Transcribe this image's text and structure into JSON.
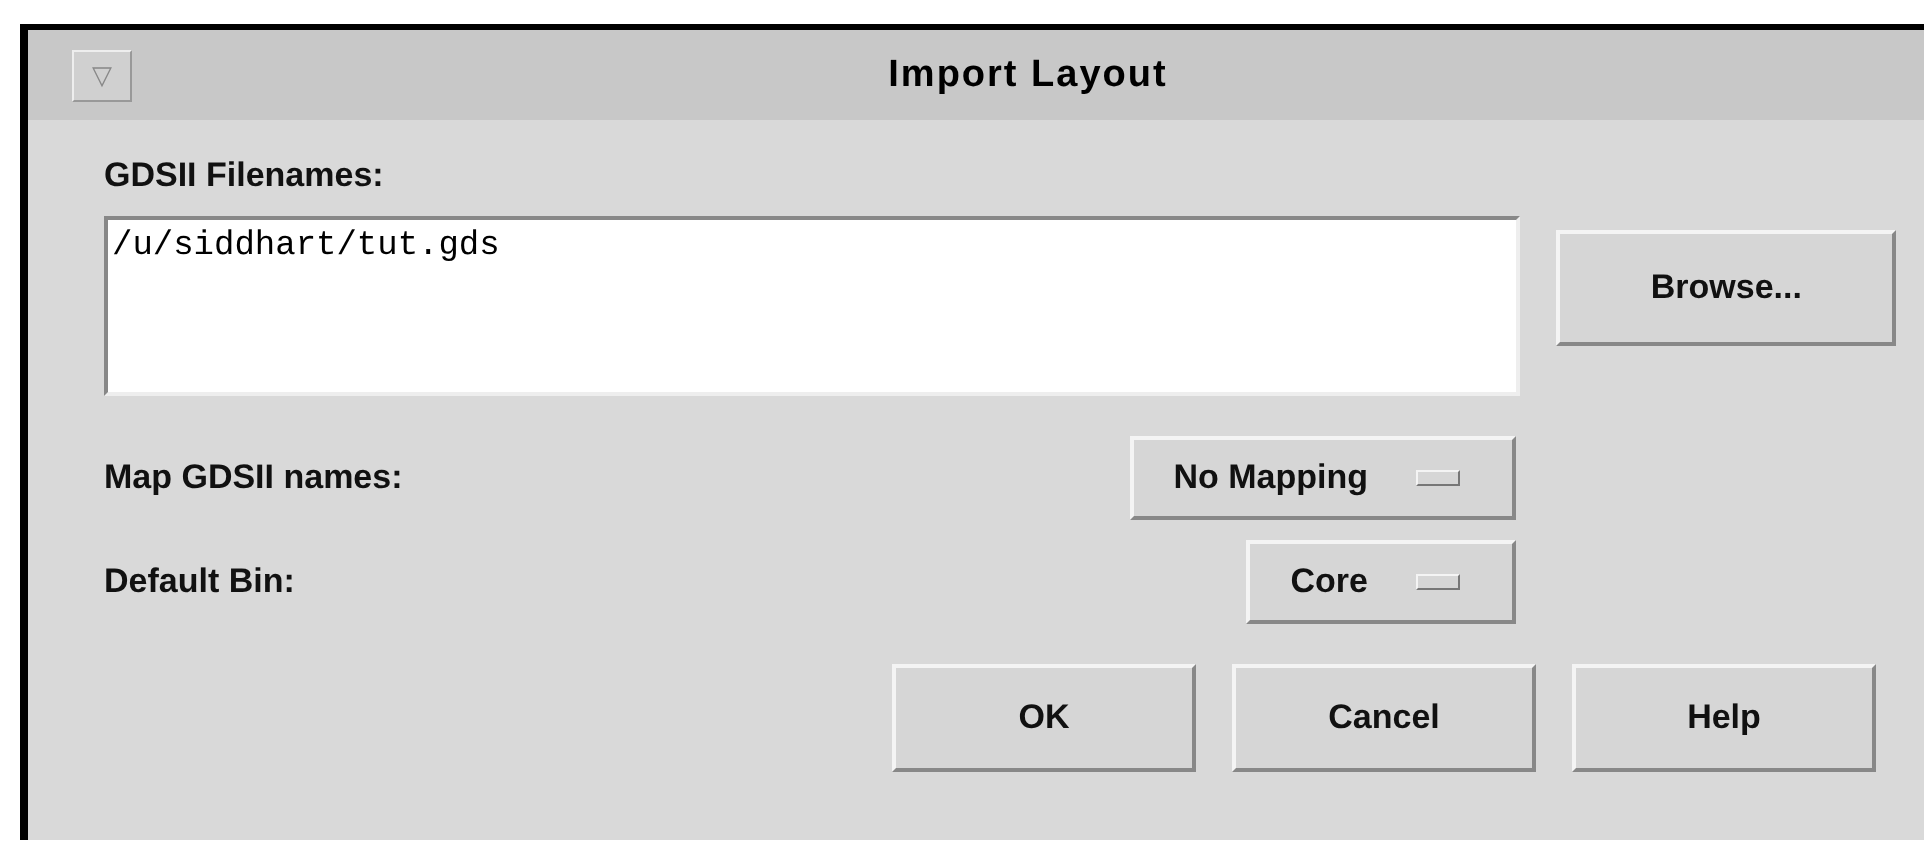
{
  "window": {
    "title": "Import Layout",
    "menu_glyph": "▽"
  },
  "filenames": {
    "label": "GDSII Filenames:",
    "value": "/u/siddhart/tut.gds"
  },
  "browse_button": "Browse...",
  "options": [
    {
      "label": "Map GDSII names:",
      "value": "No Mapping"
    },
    {
      "label": "Default Bin:",
      "value": "Core"
    }
  ],
  "buttons": [
    "OK",
    "Cancel",
    "Help"
  ]
}
